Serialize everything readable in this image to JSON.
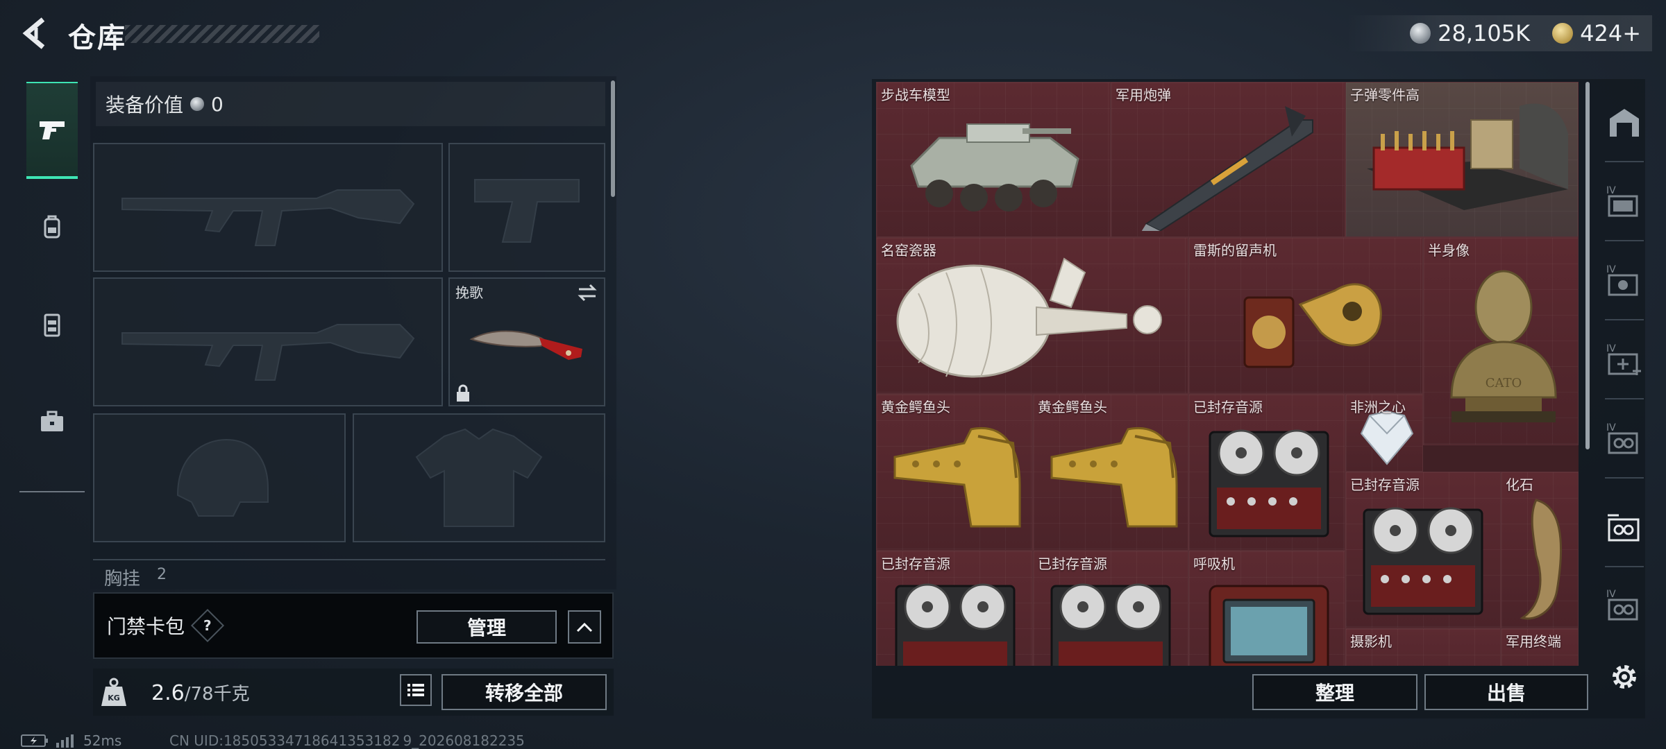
{
  "header": {
    "title": "仓库",
    "currency_silver": "28,105K",
    "currency_gold": "424+"
  },
  "left_tabs": [
    {
      "icon": "pistol-icon",
      "active": true
    },
    {
      "icon": "backpack-icon",
      "active": false
    },
    {
      "icon": "vest-icon",
      "active": false
    },
    {
      "icon": "briefcase-icon",
      "active": false
    }
  ],
  "equipment": {
    "value_label": "装备价值",
    "value": "0",
    "melee_label": "挽歌",
    "chest_label": "胸挂",
    "chest_count": "2",
    "access_card_label": "门禁卡包",
    "help_glyph": "?",
    "manage_label": "管理",
    "weight_current": "2.6",
    "weight_max": "/78千克",
    "weight_icon_text": "KG",
    "transfer_all_label": "转移全部"
  },
  "storage": {
    "items": [
      {
        "label": "步战车模型"
      },
      {
        "label": "军用炮弹"
      },
      {
        "label": "子弹零件高"
      },
      {
        "label": "名窑瓷器"
      },
      {
        "label": "雷斯的留声机"
      },
      {
        "label": "半身像"
      },
      {
        "label": "黄金鳄鱼头"
      },
      {
        "label": "黄金鳄鱼头"
      },
      {
        "label": "已封存音源"
      },
      {
        "label": "非洲之心"
      },
      {
        "label": "已封存音源"
      },
      {
        "label": "化石"
      },
      {
        "label": "已封存音源"
      },
      {
        "label": "已封存音源"
      },
      {
        "label": "呼吸机"
      },
      {
        "label": "摄影机"
      },
      {
        "label": "军用终端"
      }
    ],
    "bust_inscription": "CATO",
    "sort_label": "整理",
    "sell_label": "出售"
  },
  "right_tabs": [
    {
      "icon": "warehouse-icon"
    },
    {
      "icon": "storage-iv-1-icon",
      "tier": "IV"
    },
    {
      "icon": "storage-iv-2-icon",
      "tier": "IV"
    },
    {
      "icon": "storage-iv-add-icon",
      "tier": "IV"
    },
    {
      "icon": "storage-iv-4-icon",
      "tier": "IV"
    },
    {
      "icon": "storage-active-icon"
    },
    {
      "icon": "storage-iv-6-icon",
      "tier": "IV"
    },
    {
      "icon": "settings-icon"
    }
  ],
  "footer": {
    "ping": "52ms",
    "uid": "CN UID:18505334718641353182 ​9_202608182235"
  },
  "colors": {
    "accent": "#3ee5b4",
    "storage_bg": "#4b2329",
    "panel_bg": "#141b23"
  }
}
